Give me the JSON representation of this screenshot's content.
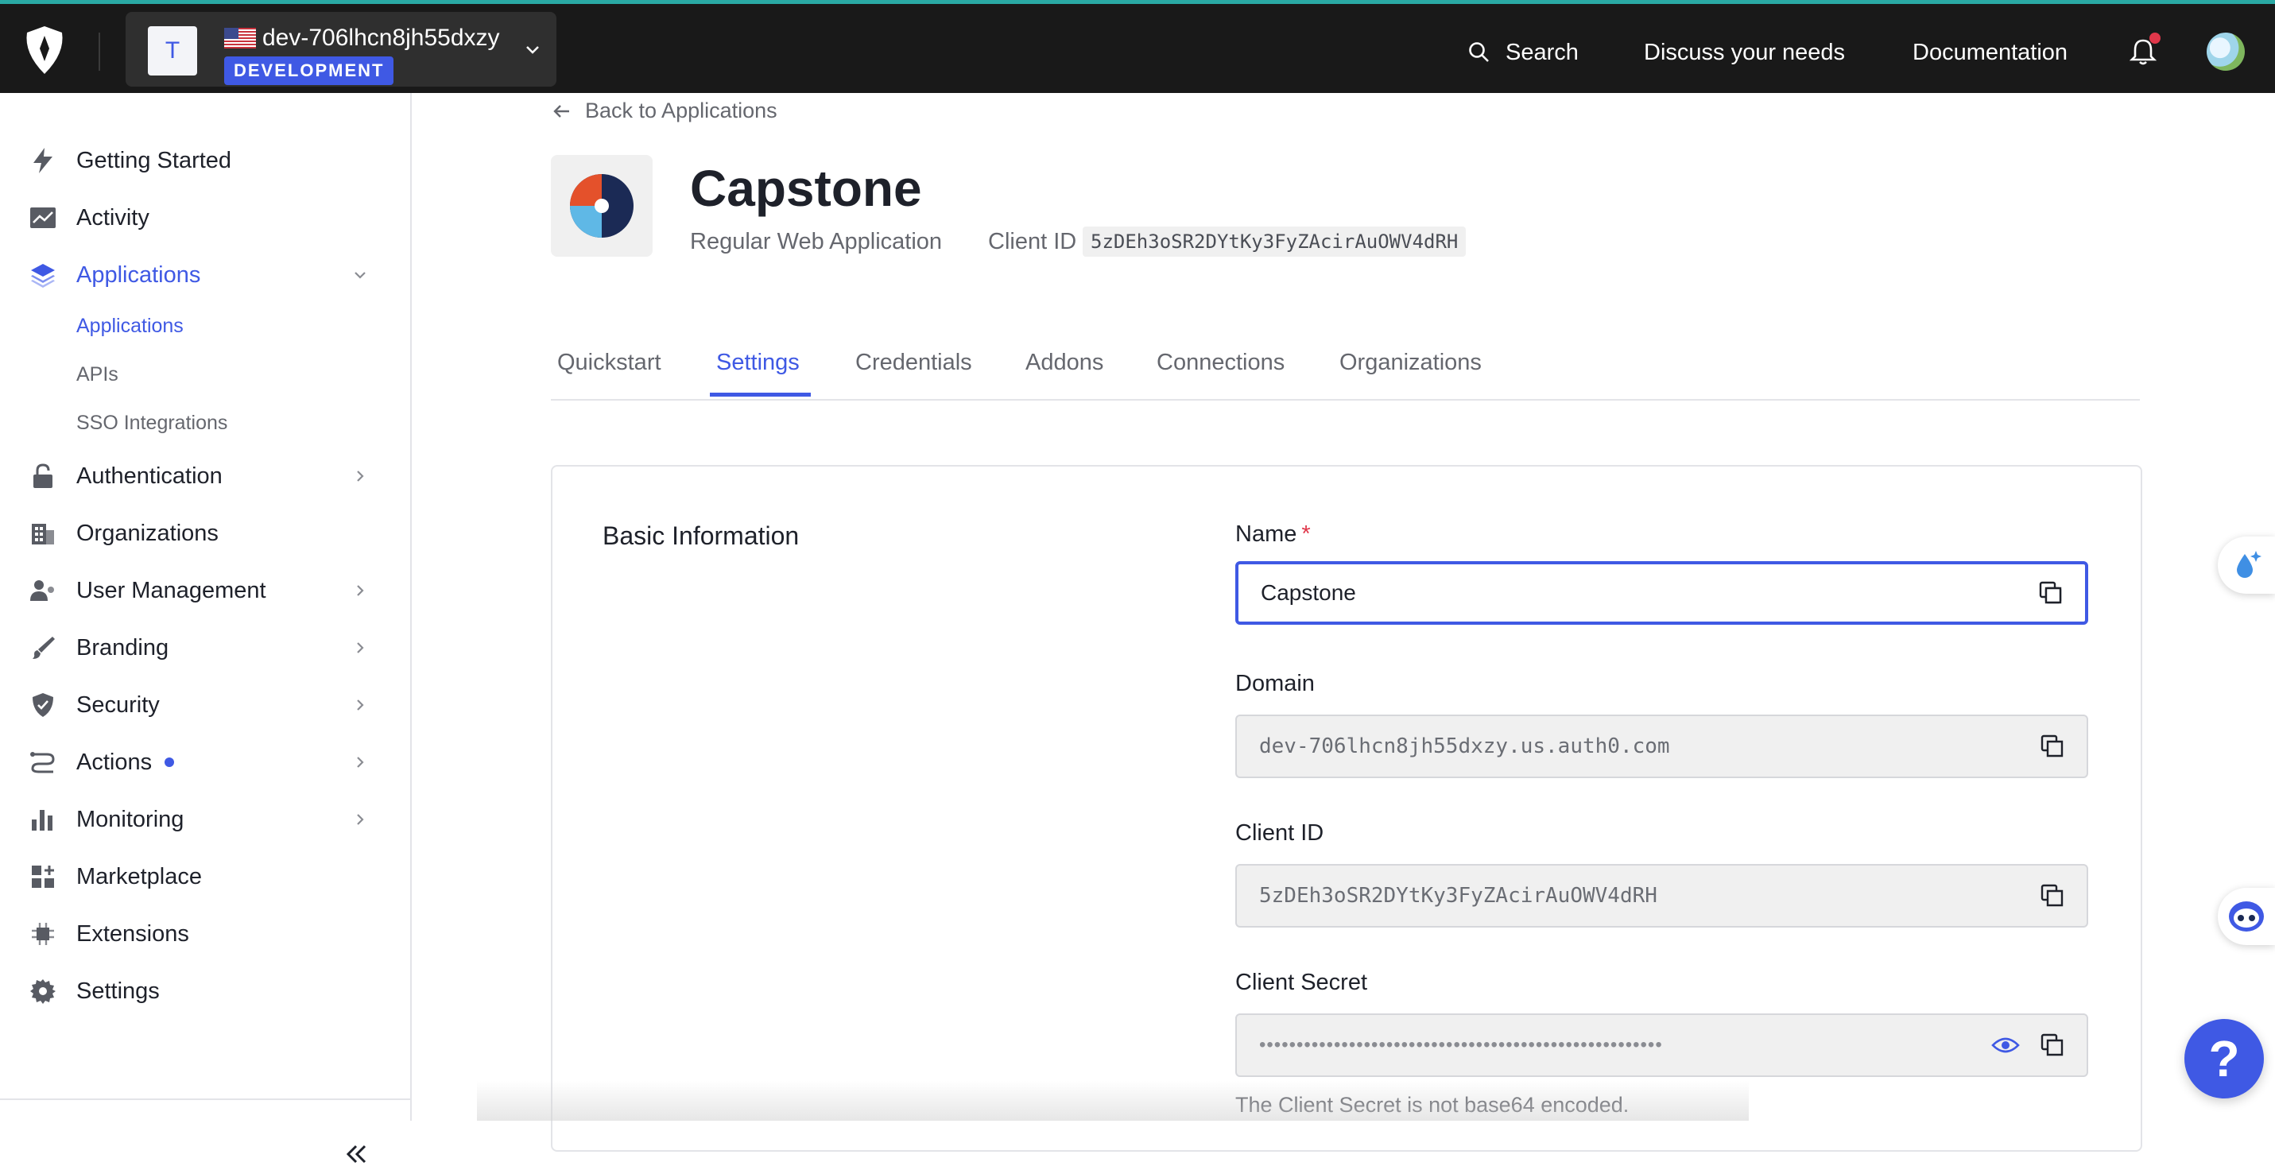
{
  "colors": {
    "accent": "#3f59e4",
    "topbar": "#191919",
    "required": "#e0374a"
  },
  "header": {
    "tenant_initial": "T",
    "tenant_name": "dev-706lhcn8jh55dxzy",
    "tenant_env": "DEVELOPMENT",
    "search_label": "Search",
    "discuss_label": "Discuss your needs",
    "docs_label": "Documentation"
  },
  "sidebar": {
    "items": [
      {
        "label": "Getting Started",
        "icon": "bolt-icon"
      },
      {
        "label": "Activity",
        "icon": "activity-chart-icon"
      },
      {
        "label": "Applications",
        "icon": "layers-icon"
      },
      {
        "label": "Authentication",
        "icon": "lock-icon"
      },
      {
        "label": "Organizations",
        "icon": "building-icon"
      },
      {
        "label": "User Management",
        "icon": "users-icon"
      },
      {
        "label": "Branding",
        "icon": "brush-icon"
      },
      {
        "label": "Security",
        "icon": "shield-icon"
      },
      {
        "label": "Actions",
        "icon": "actions-flow-icon"
      },
      {
        "label": "Monitoring",
        "icon": "bar-chart-icon"
      },
      {
        "label": "Marketplace",
        "icon": "marketplace-icon"
      },
      {
        "label": "Extensions",
        "icon": "chip-icon"
      },
      {
        "label": "Settings",
        "icon": "gear-icon"
      }
    ],
    "sub_items": [
      {
        "label": "Applications"
      },
      {
        "label": "APIs"
      },
      {
        "label": "SSO Integrations"
      }
    ]
  },
  "page": {
    "back_label": "Back to Applications",
    "app_name": "Capstone",
    "app_type": "Regular Web Application",
    "client_id_label": "Client ID",
    "client_id": "5zDEh3oSR2DYtKy3FyZAcirAuOWV4dRH"
  },
  "tabs": [
    {
      "label": "Quickstart"
    },
    {
      "label": "Settings"
    },
    {
      "label": "Credentials"
    },
    {
      "label": "Addons"
    },
    {
      "label": "Connections"
    },
    {
      "label": "Organizations"
    }
  ],
  "form": {
    "section_title": "Basic Information",
    "name_label": "Name",
    "required_mark": "*",
    "name_value": "Capstone",
    "domain_label": "Domain",
    "domain_value": "dev-706lhcn8jh55dxzy.us.auth0.com",
    "client_id_label": "Client ID",
    "client_id_value": "5zDEh3oSR2DYtKy3FyZAcirAuOWV4dRH",
    "secret_label": "Client Secret",
    "secret_mask": "••••••••••••••••••••••••••••••••••••••••••••••••••••••",
    "secret_helper": "The Client Secret is not base64 encoded."
  },
  "help": {
    "label": "?"
  }
}
